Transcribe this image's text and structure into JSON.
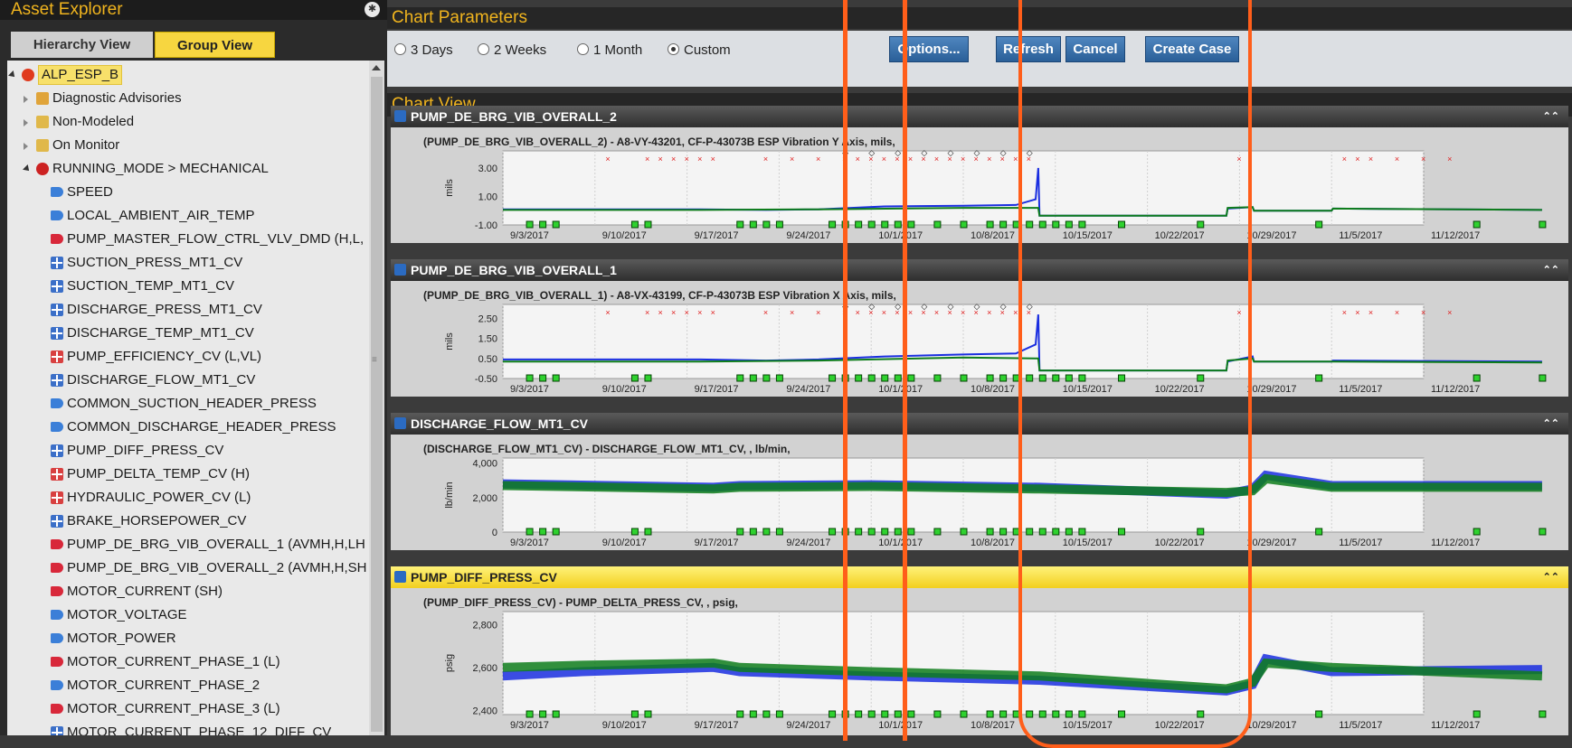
{
  "asset_explorer": {
    "title": "Asset Explorer",
    "tabs": [
      "Hierarchy View",
      "Group View"
    ],
    "selected_tab": "Group View",
    "tree": [
      {
        "label": "ALP_ESP_B",
        "icon": "gear-icon",
        "level": 0,
        "expanded": true,
        "selected": true
      },
      {
        "label": "Diagnostic Advisories",
        "icon": "advisory-folder-icon",
        "level": 1,
        "expanded": false
      },
      {
        "label": "Non-Modeled",
        "icon": "folder-icon",
        "level": 1,
        "expanded": false
      },
      {
        "label": "On Monitor",
        "icon": "folder-icon",
        "level": 1,
        "expanded": false
      },
      {
        "label": "RUNNING_MODE > MECHANICAL",
        "icon": "mode-icon",
        "level": 1,
        "expanded": true
      },
      {
        "label": "SPEED",
        "icon": "tag-blue-icon",
        "level": 2
      },
      {
        "label": "LOCAL_AMBIENT_AIR_TEMP",
        "icon": "tag-blue-icon",
        "level": 2
      },
      {
        "label": "PUMP_MASTER_FLOW_CTRL_VLV_DMD (H,L,",
        "icon": "tag-red-icon",
        "level": 2
      },
      {
        "label": "SUCTION_PRESS_MT1_CV",
        "icon": "calc-blue-icon",
        "level": 2
      },
      {
        "label": "SUCTION_TEMP_MT1_CV",
        "icon": "calc-blue-icon",
        "level": 2
      },
      {
        "label": "DISCHARGE_PRESS_MT1_CV",
        "icon": "calc-blue-icon",
        "level": 2
      },
      {
        "label": "DISCHARGE_TEMP_MT1_CV",
        "icon": "calc-blue-icon",
        "level": 2
      },
      {
        "label": "PUMP_EFFICIENCY_CV (L,VL)",
        "icon": "calc-red-icon",
        "level": 2
      },
      {
        "label": "DISCHARGE_FLOW_MT1_CV",
        "icon": "calc-blue-icon",
        "level": 2
      },
      {
        "label": "COMMON_SUCTION_HEADER_PRESS",
        "icon": "tag-blue-icon",
        "level": 2
      },
      {
        "label": "COMMON_DISCHARGE_HEADER_PRESS",
        "icon": "tag-blue-icon",
        "level": 2
      },
      {
        "label": "PUMP_DIFF_PRESS_CV",
        "icon": "calc-blue-icon",
        "level": 2
      },
      {
        "label": "PUMP_DELTA_TEMP_CV (H)",
        "icon": "calc-red-icon",
        "level": 2
      },
      {
        "label": "HYDRAULIC_POWER_CV (L)",
        "icon": "calc-red-icon",
        "level": 2
      },
      {
        "label": "BRAKE_HORSEPOWER_CV",
        "icon": "calc-blue-icon",
        "level": 2
      },
      {
        "label": "PUMP_DE_BRG_VIB_OVERALL_1 (AVMH,H,LH",
        "icon": "tag-red-icon",
        "level": 2
      },
      {
        "label": "PUMP_DE_BRG_VIB_OVERALL_2 (AVMH,H,SH",
        "icon": "tag-red-icon",
        "level": 2
      },
      {
        "label": "MOTOR_CURRENT (SH)",
        "icon": "tag-red-icon",
        "level": 2
      },
      {
        "label": "MOTOR_VOLTAGE",
        "icon": "tag-blue-icon",
        "level": 2
      },
      {
        "label": "MOTOR_POWER",
        "icon": "tag-blue-icon",
        "level": 2
      },
      {
        "label": "MOTOR_CURRENT_PHASE_1 (L)",
        "icon": "tag-red-icon",
        "level": 2
      },
      {
        "label": "MOTOR_CURRENT_PHASE_2",
        "icon": "tag-blue-icon",
        "level": 2
      },
      {
        "label": "MOTOR_CURRENT_PHASE_3 (L)",
        "icon": "tag-red-icon",
        "level": 2
      },
      {
        "label": "MOTOR_CURRENT_PHASE_12_DIFF_CV",
        "icon": "calc-blue-icon",
        "level": 2
      }
    ]
  },
  "chart_parameters": {
    "title": "Chart Parameters",
    "ranges": [
      "3 Days",
      "2 Weeks",
      "1 Month",
      "Custom"
    ],
    "selected_range": "Custom",
    "buttons": {
      "options": "Options...",
      "refresh": "Refresh",
      "cancel": "Cancel",
      "create_case": "Create Case"
    }
  },
  "chart_view_title": "Chart View",
  "colors": {
    "accent": "#f0b41e",
    "series_blue": "#1a2ee0",
    "series_green": "#0e7d1b",
    "alert_red": "#e02020",
    "annotation": "#ff5e1a",
    "selected_header": "#f7d640"
  },
  "chart_data": [
    {
      "type": "line",
      "title": "PUMP_DE_BRG_VIB_OVERALL_2",
      "subtitle": "(PUMP_DE_BRG_VIB_OVERALL_2) - A8-VY-43201, CF-P-43073B ESP Vibration Y Axis, mils,",
      "ylabel": "mils",
      "yticks": [
        "3.00",
        "1.00",
        "-1.00"
      ],
      "ylim": [
        -1.0,
        4.2
      ],
      "xticks": [
        "9/3/2017",
        "9/10/2017",
        "9/17/2017",
        "9/24/2017",
        "10/1/2017",
        "10/8/2017",
        "10/15/2017",
        "10/22/2017",
        "10/29/2017",
        "11/5/2017",
        "11/12/2017"
      ],
      "series": [
        {
          "values": [
            [
              0,
              0.1
            ],
            [
              15,
              0.1
            ],
            [
              20,
              0.05
            ],
            [
              24,
              0.1
            ],
            [
              29,
              0.3
            ],
            [
              35,
              0.35
            ],
            [
              39,
              0.4
            ],
            [
              40.5,
              0.8
            ],
            [
              40.7,
              3.0
            ],
            [
              40.8,
              -0.35
            ],
            [
              55,
              -0.35
            ],
            [
              55.1,
              0.15
            ],
            [
              57,
              0.25
            ],
            [
              57.1,
              0.0
            ],
            [
              63,
              0.0
            ],
            [
              63.1,
              0.15
            ],
            [
              79,
              0.05
            ]
          ]
        },
        {
          "values": [
            [
              0,
              0.05
            ],
            [
              15,
              0.05
            ],
            [
              24,
              0.1
            ],
            [
              35,
              0.2
            ],
            [
              40.7,
              0.2
            ],
            [
              40.8,
              -0.35
            ],
            [
              55,
              -0.35
            ],
            [
              55.1,
              0.2
            ],
            [
              57,
              0.25
            ],
            [
              57.1,
              0.0
            ],
            [
              63,
              0.0
            ],
            [
              63.1,
              0.15
            ],
            [
              79,
              0.05
            ]
          ]
        }
      ]
    },
    {
      "type": "line",
      "title": "PUMP_DE_BRG_VIB_OVERALL_1",
      "subtitle": "(PUMP_DE_BRG_VIB_OVERALL_1) - A8-VX-43199, CF-P-43073B ESP Vibration X Axis, mils,",
      "ylabel": "mils",
      "yticks": [
        "2.50",
        "1.50",
        "0.50",
        "-0.50"
      ],
      "ylim": [
        -0.5,
        3.2
      ],
      "xticks": [
        "9/3/2017",
        "9/10/2017",
        "9/17/2017",
        "9/24/2017",
        "10/1/2017",
        "10/8/2017",
        "10/15/2017",
        "10/22/2017",
        "10/29/2017",
        "11/5/2017",
        "11/12/2017"
      ],
      "series": [
        {
          "values": [
            [
              0,
              0.45
            ],
            [
              15,
              0.45
            ],
            [
              20,
              0.4
            ],
            [
              24,
              0.45
            ],
            [
              29,
              0.6
            ],
            [
              35,
              0.7
            ],
            [
              39,
              0.75
            ],
            [
              40.5,
              1.2
            ],
            [
              40.7,
              2.7
            ],
            [
              40.8,
              -0.1
            ],
            [
              55,
              -0.1
            ],
            [
              55.1,
              0.35
            ],
            [
              57,
              0.6
            ],
            [
              57.1,
              0.35
            ],
            [
              63,
              0.35
            ],
            [
              63.1,
              0.4
            ],
            [
              79,
              0.35
            ]
          ]
        },
        {
          "values": [
            [
              0,
              0.35
            ],
            [
              15,
              0.35
            ],
            [
              24,
              0.4
            ],
            [
              35,
              0.55
            ],
            [
              40.7,
              0.5
            ],
            [
              40.8,
              -0.1
            ],
            [
              55,
              -0.1
            ],
            [
              55.1,
              0.4
            ],
            [
              57,
              0.5
            ],
            [
              57.1,
              0.35
            ],
            [
              63,
              0.35
            ],
            [
              63.1,
              0.35
            ],
            [
              79,
              0.3
            ]
          ]
        }
      ]
    },
    {
      "type": "line",
      "title": "DISCHARGE_FLOW_MT1_CV",
      "subtitle": "(DISCHARGE_FLOW_MT1_CV) - DISCHARGE_FLOW_MT1_CV, , lb/min,",
      "ylabel": "lb/min",
      "yticks": [
        "4,000",
        "2,000",
        "0"
      ],
      "ylim": [
        0,
        4300
      ],
      "xticks": [
        "9/3/2017",
        "9/10/2017",
        "9/17/2017",
        "9/24/2017",
        "10/1/2017",
        "10/8/2017",
        "10/15/2017",
        "10/22/2017",
        "10/29/2017",
        "11/5/2017",
        "11/12/2017"
      ],
      "series": [
        {
          "values": [
            [
              0,
              2800
            ],
            [
              16,
              2600
            ],
            [
              18,
              2700
            ],
            [
              28,
              2750
            ],
            [
              40.8,
              2600
            ],
            [
              55,
              2200
            ],
            [
              57,
              2500
            ],
            [
              58,
              3300
            ],
            [
              63,
              2700
            ],
            [
              79,
              2700
            ]
          ]
        },
        {
          "values": [
            [
              0,
              2700
            ],
            [
              16,
              2500
            ],
            [
              18,
              2600
            ],
            [
              28,
              2650
            ],
            [
              40.8,
              2500
            ],
            [
              55,
              2300
            ],
            [
              57,
              2400
            ],
            [
              58,
              3100
            ],
            [
              63,
              2600
            ],
            [
              79,
              2600
            ]
          ]
        }
      ]
    },
    {
      "type": "line",
      "title": "PUMP_DIFF_PRESS_CV",
      "subtitle": "(PUMP_DIFF_PRESS_CV) - PUMP_DELTA_PRESS_CV, , psig,",
      "ylabel": "psig",
      "yticks": [
        "2,800",
        "2,600",
        "2,400"
      ],
      "ylim": [
        2380,
        2860
      ],
      "xticks": [
        "9/3/2017",
        "9/10/2017",
        "9/17/2017",
        "9/24/2017",
        "10/1/2017",
        "10/8/2017",
        "10/15/2017",
        "10/22/2017",
        "10/29/2017",
        "11/5/2017",
        "11/12/2017"
      ],
      "series": [
        {
          "values": [
            [
              0,
              2560
            ],
            [
              6,
              2580
            ],
            [
              16,
              2600
            ],
            [
              18,
              2580
            ],
            [
              28,
              2560
            ],
            [
              40.8,
              2540
            ],
            [
              55,
              2490
            ],
            [
              57,
              2520
            ],
            [
              58,
              2640
            ],
            [
              63,
              2580
            ],
            [
              79,
              2590
            ]
          ]
        },
        {
          "values": [
            [
              0,
              2600
            ],
            [
              6,
              2610
            ],
            [
              16,
              2620
            ],
            [
              18,
              2600
            ],
            [
              28,
              2580
            ],
            [
              40.8,
              2560
            ],
            [
              55,
              2500
            ],
            [
              57,
              2530
            ],
            [
              58,
              2620
            ],
            [
              63,
              2600
            ],
            [
              79,
              2560
            ]
          ]
        }
      ]
    }
  ]
}
